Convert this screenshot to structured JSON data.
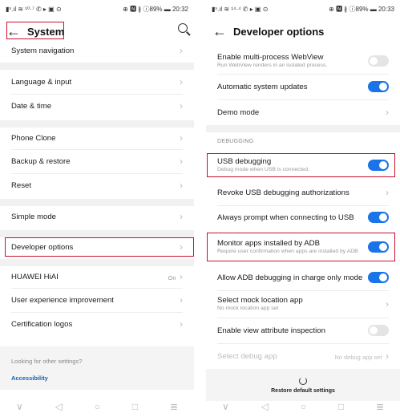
{
  "left": {
    "status": {
      "left": "▮ᵛ.ıl ≋ ¹⁰·⁷ ✆ ▸ ▣ ⊙",
      "right": "⊕ 🅽 ∦ ⓘ89% ▬ 20:32"
    },
    "title": "System",
    "items": [
      {
        "label": "System navigation"
      },
      {
        "label": "Language & input"
      },
      {
        "label": "Date & time"
      },
      {
        "label": "Phone Clone"
      },
      {
        "label": "Backup & restore"
      },
      {
        "label": "Reset"
      },
      {
        "label": "Simple mode"
      },
      {
        "label": "Developer options"
      },
      {
        "label": "HUAWEI HiAI",
        "value": "On"
      },
      {
        "label": "User experience improvement"
      },
      {
        "label": "Certification logos"
      }
    ],
    "card": {
      "question": "Looking for other settings?",
      "link": "Accessibility"
    }
  },
  "right": {
    "status": {
      "left": "▮ᵛ.ıl ≋ ¹⁴·⁴ ✆ ▸ ▣ ⊙",
      "right": "⊕ 🅽 ∦ ⓘ89% ▬ 20:33"
    },
    "title": "Developer options",
    "items": [
      {
        "label": "Enable multi-process WebView",
        "sub": "Run WebView renders in an isolated process.",
        "toggle": false
      },
      {
        "label": "Automatic system updates",
        "toggle": true
      },
      {
        "label": "Demo mode"
      },
      {
        "label": "USB debugging",
        "sub": "Debug mode when USB is connected.",
        "toggle": true
      },
      {
        "label": "Revoke USB debugging authorizations"
      },
      {
        "label": "Always prompt when connecting to USB",
        "toggle": true
      },
      {
        "label": "Monitor apps installed by ADB",
        "sub": "Require user confirmation when apps are installed by ADB",
        "toggle": true
      },
      {
        "label": "Allow ADB debugging in charge only mode",
        "toggle": true
      },
      {
        "label": "Select mock location app",
        "sub": "No mock location app set"
      },
      {
        "label": "Enable view attribute inspection",
        "toggle": false
      },
      {
        "label": "Select debug app",
        "value": "No debug app set"
      }
    ],
    "section": "DEBUGGING",
    "restore": "Restore default settings"
  },
  "icons": [
    "back-arrow-icon",
    "search-icon",
    "chevron-right-icon",
    "toggle-switch",
    "restore-icon",
    "nav-back-icon",
    "nav-home-icon",
    "nav-recents-icon",
    "nav-dropdown-icon"
  ],
  "colors": {
    "accent": "#1a73e8",
    "highlight": "#c8102e",
    "link": "#1a5fb4"
  }
}
